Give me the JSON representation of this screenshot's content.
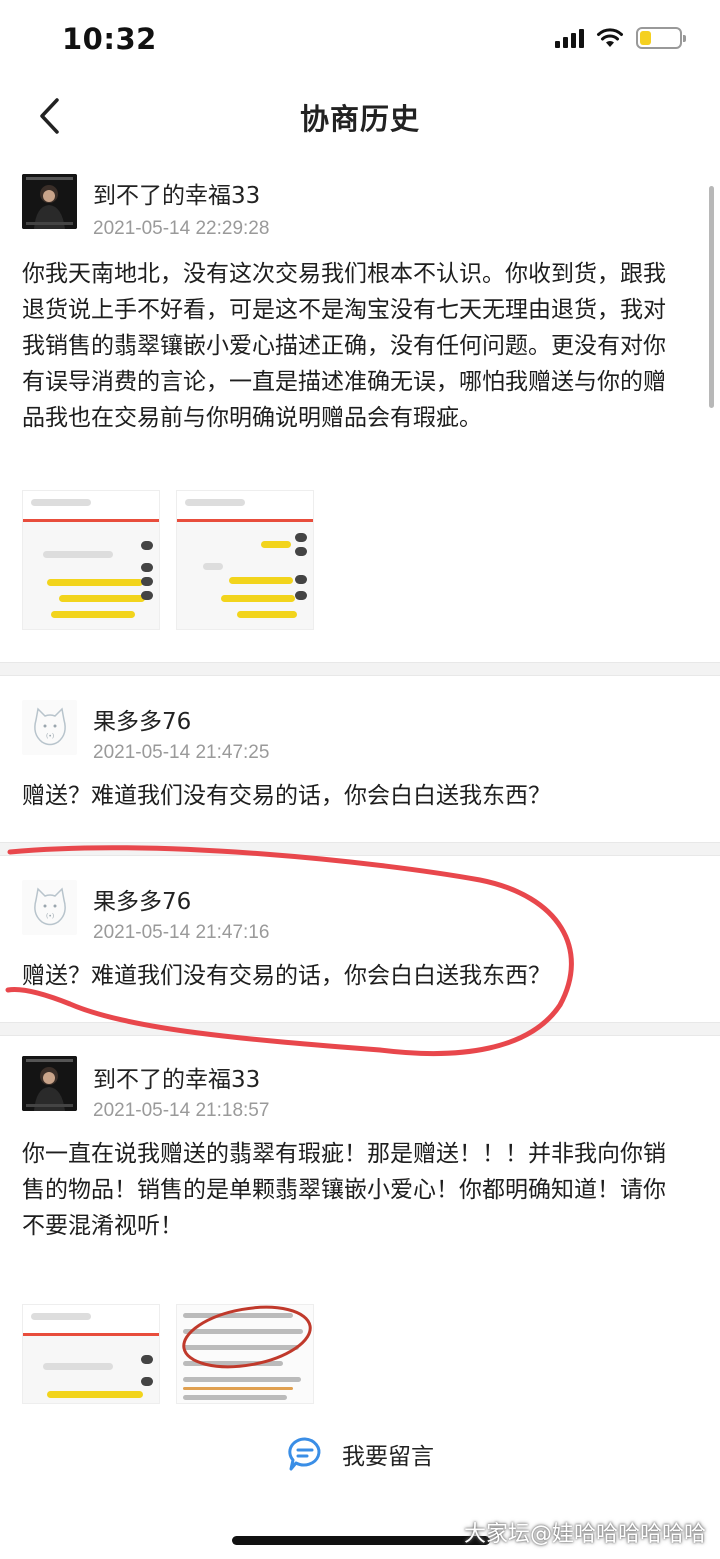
{
  "status_bar": {
    "time": "10:32"
  },
  "nav": {
    "title": "协商历史"
  },
  "messages": [
    {
      "username": "到不了的幸福33",
      "timestamp": "2021-05-14 22:29:28",
      "text": "你我天南地北，没有这次交易我们根本不认识。你收到货，跟我退货说上手不好看，可是这不是淘宝没有七天无理由退货，我对我销售的翡翠镶嵌小爱心描述正确，没有任何问题。更没有对你有误导消费的言论，一直是描述准确无误，哪怕我赠送与你的赠品我也在交易前与你明确说明赠品会有瑕疵。"
    },
    {
      "username": "果多多76",
      "timestamp": "2021-05-14 21:47:25",
      "text": "赠送？难道我们没有交易的话，你会白白送我东西？"
    },
    {
      "username": "果多多76",
      "timestamp": "2021-05-14 21:47:16",
      "text": "赠送？难道我们没有交易的话，你会白白送我东西？"
    },
    {
      "username": "到不了的幸福33",
      "timestamp": "2021-05-14 21:18:57",
      "text": "你一直在说我赠送的翡翠有瑕疵！那是赠送！！！并非我向你销售的物品！销售的是单颗翡翠镶嵌小爱心！你都明确知道！请你不要混淆视听！"
    }
  ],
  "footer": {
    "leave_message": "我要留言"
  },
  "watermark": "大家坛@娃哈哈哈哈哈哈",
  "colors": {
    "annotation_red": "#e8474c",
    "accent_blue": "#3a8ee6",
    "battery_yellow": "#f5d020"
  },
  "icons": {
    "back": "chevron-left-icon",
    "comment": "chat-bubble-icon",
    "signal": "signal-icon",
    "wifi": "wifi-icon",
    "battery": "battery-icon"
  }
}
